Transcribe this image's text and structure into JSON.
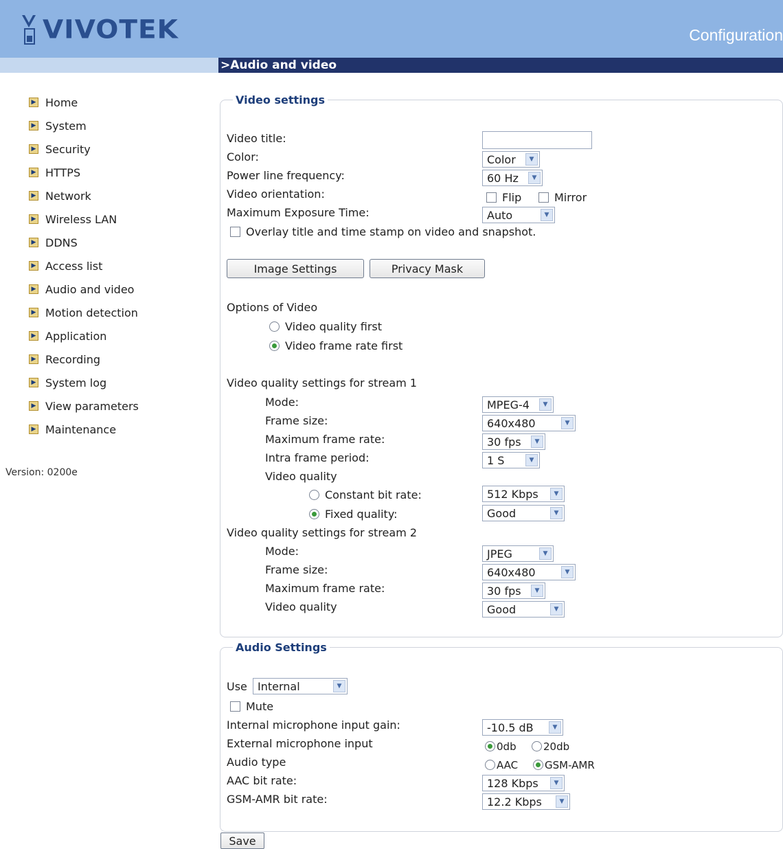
{
  "brand": {
    "logo_text": "VIVOTEK",
    "header_title": "Configuration"
  },
  "section_title": ">Audio and video",
  "nav": [
    "Home",
    "System",
    "Security",
    "HTTPS",
    "Network",
    "Wireless LAN",
    "DDNS",
    "Access list",
    "Audio and video",
    "Motion detection",
    "Application",
    "Recording",
    "System log",
    "View parameters",
    "Maintenance"
  ],
  "version": "Version: 0200e",
  "video": {
    "legend": "Video settings",
    "title_label": "Video title:",
    "title_value": "",
    "color_label": "Color:",
    "color_value": "Color",
    "power_label": "Power line frequency:",
    "power_value": "60 Hz",
    "orientation_label": "Video orientation:",
    "flip_label": "Flip",
    "mirror_label": "Mirror",
    "exposure_label": "Maximum Exposure Time:",
    "exposure_value": "Auto",
    "overlay_label": "Overlay title and time stamp on video and snapshot.",
    "image_settings_btn": "Image Settings",
    "privacy_mask_btn": "Privacy Mask",
    "options_label": "Options of Video",
    "opt_quality_first": "Video quality first",
    "opt_framerate_first": "Video frame rate first",
    "stream1": {
      "heading": "Video quality settings for stream 1",
      "mode_label": "Mode:",
      "mode_value": "MPEG-4",
      "frame_size_label": "Frame size:",
      "frame_size_value": "640x480",
      "max_rate_label": "Maximum frame rate:",
      "max_rate_value": "30 fps",
      "intra_label": "Intra frame period:",
      "intra_value": "1 S",
      "quality_label": "Video quality",
      "cbr_label": "Constant bit rate:",
      "cbr_value": "512 Kbps",
      "fixed_label": "Fixed quality:",
      "fixed_value": "Good"
    },
    "stream2": {
      "heading": "Video quality settings for stream 2",
      "mode_label": "Mode:",
      "mode_value": "JPEG",
      "frame_size_label": "Frame size:",
      "frame_size_value": "640x480",
      "max_rate_label": "Maximum frame rate:",
      "max_rate_value": "30 fps",
      "quality_label": "Video quality",
      "quality_value": "Good"
    }
  },
  "audio": {
    "legend": "Audio Settings",
    "use_label": "Use",
    "use_value": "Internal",
    "mute_label": "Mute",
    "gain_label": "Internal microphone input gain:",
    "gain_value": "-10.5 dB",
    "ext_label": "External microphone input",
    "ext_opt1": "0db",
    "ext_opt2": "20db",
    "type_label": "Audio type",
    "type_opt1": "AAC",
    "type_opt2": "GSM-AMR",
    "aac_label": "AAC bit rate:",
    "aac_value": "128 Kbps",
    "gsm_label": "GSM-AMR bit rate:",
    "gsm_value": "12.2 Kbps"
  },
  "save_btn": "Save",
  "colors": {
    "header_bg": "#8eb4e3",
    "section_bar": "#21336a",
    "legend_text": "#1d3e7a"
  }
}
